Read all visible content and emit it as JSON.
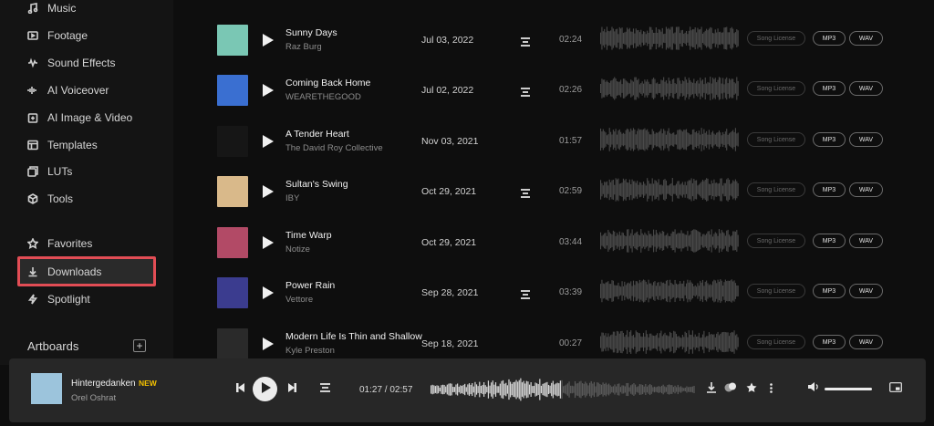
{
  "sidebar": {
    "items": [
      {
        "label": "Music",
        "icon": "music-note-icon"
      },
      {
        "label": "Footage",
        "icon": "play-box-icon"
      },
      {
        "label": "Sound Effects",
        "icon": "waveform-icon"
      },
      {
        "label": "AI Voiceover",
        "icon": "voice-bars-icon"
      },
      {
        "label": "AI Image & Video",
        "icon": "image-plus-icon"
      },
      {
        "label": "Templates",
        "icon": "template-icon"
      },
      {
        "label": "LUTs",
        "icon": "lut-icon"
      },
      {
        "label": "Tools",
        "icon": "cube-icon"
      },
      {
        "label": "Favorites",
        "icon": "star-icon"
      },
      {
        "label": "Downloads",
        "icon": "download-icon",
        "highlighted": true
      },
      {
        "label": "Spotlight",
        "icon": "bolt-icon"
      }
    ],
    "artboards_label": "Artboards",
    "artboards_add": "+"
  },
  "tracks": [
    {
      "title": "Sunny Days",
      "artist": "Raz Burg",
      "date": "Jul 03, 2022",
      "duration": "02:24",
      "stems": true,
      "cover_color": "#7ac7b4"
    },
    {
      "title": "Coming Back Home",
      "artist": "WEARETHEGOOD",
      "date": "Jul 02, 2022",
      "duration": "02:26",
      "stems": true,
      "cover_color": "#3a6fd1"
    },
    {
      "title": "A Tender Heart",
      "artist": "The David Roy Collective",
      "date": "Nov 03, 2021",
      "duration": "01:57",
      "stems": false,
      "cover_color": "#161616"
    },
    {
      "title": "Sultan's Swing",
      "artist": "IBY",
      "date": "Oct 29, 2021",
      "duration": "02:59",
      "stems": true,
      "cover_color": "#d9b98a"
    },
    {
      "title": "Time Warp",
      "artist": "Notize",
      "date": "Oct 29, 2021",
      "duration": "03:44",
      "stems": false,
      "cover_color": "#b24a66"
    },
    {
      "title": "Power Rain",
      "artist": "Vettore",
      "date": "Sep 28, 2021",
      "duration": "03:39",
      "stems": true,
      "cover_color": "#3b3c8f"
    },
    {
      "title": "Modern Life Is Thin and Shallow",
      "artist": "Kyle Preston",
      "date": "Sep 18, 2021",
      "duration": "00:27",
      "stems": false,
      "cover_color": "#2a2a2a"
    }
  ],
  "track_buttons": {
    "license": "Song License",
    "mp3": "MP3",
    "wav": "WAV"
  },
  "player": {
    "title": "Hintergedanken",
    "badge": "NEW",
    "artist": "Orel Oshrat",
    "time": "01:27 / 02:57",
    "progress": 0.49,
    "volume": 1.0,
    "cover_color": "#9cc4dc"
  },
  "colors": {
    "highlight": "#e24d55",
    "badge": "#f3c000"
  }
}
